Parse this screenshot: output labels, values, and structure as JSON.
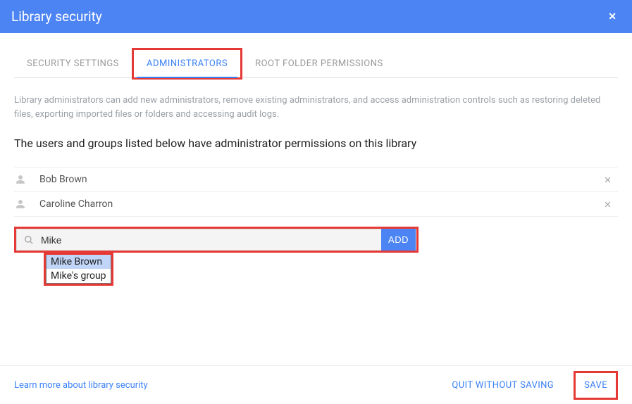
{
  "header": {
    "title": "Library security"
  },
  "tabs": {
    "security": "SECURITY SETTINGS",
    "administrators": "ADMINISTRATORS",
    "root_perms": "ROOT FOLDER PERMISSIONS"
  },
  "description": "Library administrators can add new administrators, remove existing administrators, and access administration controls such as restoring deleted files, exporting imported files or folders and accessing audit logs.",
  "subheading": "The users and groups listed below have administrator permissions on this library",
  "admins": [
    {
      "name": "Bob Brown"
    },
    {
      "name": "Caroline Charron"
    }
  ],
  "search": {
    "value": "Mike",
    "add_label": "ADD"
  },
  "suggestions": [
    "Mike Brown",
    "Mike's group"
  ],
  "footer": {
    "learn_more": "Learn more about library security",
    "quit": "QUIT WITHOUT SAVING",
    "save": "SAVE"
  }
}
